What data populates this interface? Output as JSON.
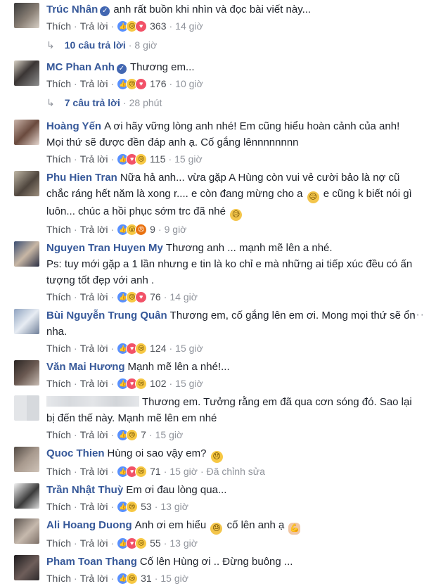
{
  "labels": {
    "like": "Thích",
    "reply": "Trả lời",
    "dot": "·"
  },
  "comments": [
    {
      "name": "Trúc Nhân",
      "verified": true,
      "text": "anh rất buồn khi nhìn và đọc bài viết này...",
      "count": "363",
      "time": "14 giờ",
      "replies": "10 câu trả lời",
      "replies_time": "8 giờ"
    },
    {
      "name": "MC Phan Anh",
      "verified": true,
      "text": "Thương em...",
      "count": "176",
      "time": "10 giờ",
      "replies": "7 câu trả lời",
      "replies_time": "28 phút"
    },
    {
      "name": "Hoàng Yến",
      "text": "A ơi hãy vững lòng anh nhé! Em cũng hiểu hoàn cảnh của anh! Mọi thứ sẽ được đền đáp anh ạ. Cố gắng lênnnnnnnn",
      "count": "115",
      "time": "15 giờ"
    },
    {
      "name": "Phu Hien Tran",
      "text_a": "Nữa hả anh... vừa gặp A Hùng còn vui vẻ cười bảo là nợ cũ chắc ráng hết năm là xong r.... e còn đang mừng cho a",
      "text_b": "e cũng k biết nói gì luôn... chúc a hồi phục sớm trc đã nhé",
      "count": "9",
      "time": "9 giờ"
    },
    {
      "name": "Nguyen Tran Huyen My",
      "text": "Thương anh ... mạnh mẽ lên a nhé.",
      "text2": "Ps: tuy mới gặp a 1 lần nhưng e tin là ko chỉ e mà những ai tiếp xúc đều có ấn tượng tốt đẹp với anh .",
      "count": "76",
      "time": "14 giờ"
    },
    {
      "name": "Bùi Nguyễn Trung Quân",
      "text": "Thương em, cố gắng lên em ơi. Mong mọi thứ sẽ ổn nha.",
      "count": "124",
      "time": "15 giờ",
      "more": "···"
    },
    {
      "name": "Văn Mai Hương",
      "text": "Mạnh mẽ lên a nhé!...",
      "count": "102",
      "time": "15 giờ"
    },
    {
      "text": "Thương em. Tưởng rằng em đã qua cơn sóng đó. Sao lại bị đến thế này. Mạnh mẽ lên em nhé",
      "count": "7",
      "time": "15 giờ"
    },
    {
      "name": "Quoc Thien",
      "text": "Hùng oi sao vậy em?",
      "count": "71",
      "time": "15 giờ",
      "edited": "Đã chỉnh sửa"
    },
    {
      "name": "Trần Nhật Thuỳ",
      "text": "Em ơi đau lòng qua...",
      "count": "53",
      "time": "13 giờ"
    },
    {
      "name": "Ali Hoang Duong",
      "text_a": "Anh ơi em hiểu",
      "text_b": "cố lên anh ạ",
      "count": "55",
      "time": "13 giờ"
    },
    {
      "name": "Pham Toan Thang",
      "text": "Cố lên Hùng ơi .. Đừng buông ...",
      "count": "31",
      "time": "15 giờ"
    }
  ],
  "icons": {
    "reply_arrow": "↳",
    "like": "👍",
    "love": "♥",
    "sad": "😢",
    "wow": "😮",
    "angry": "😠"
  }
}
